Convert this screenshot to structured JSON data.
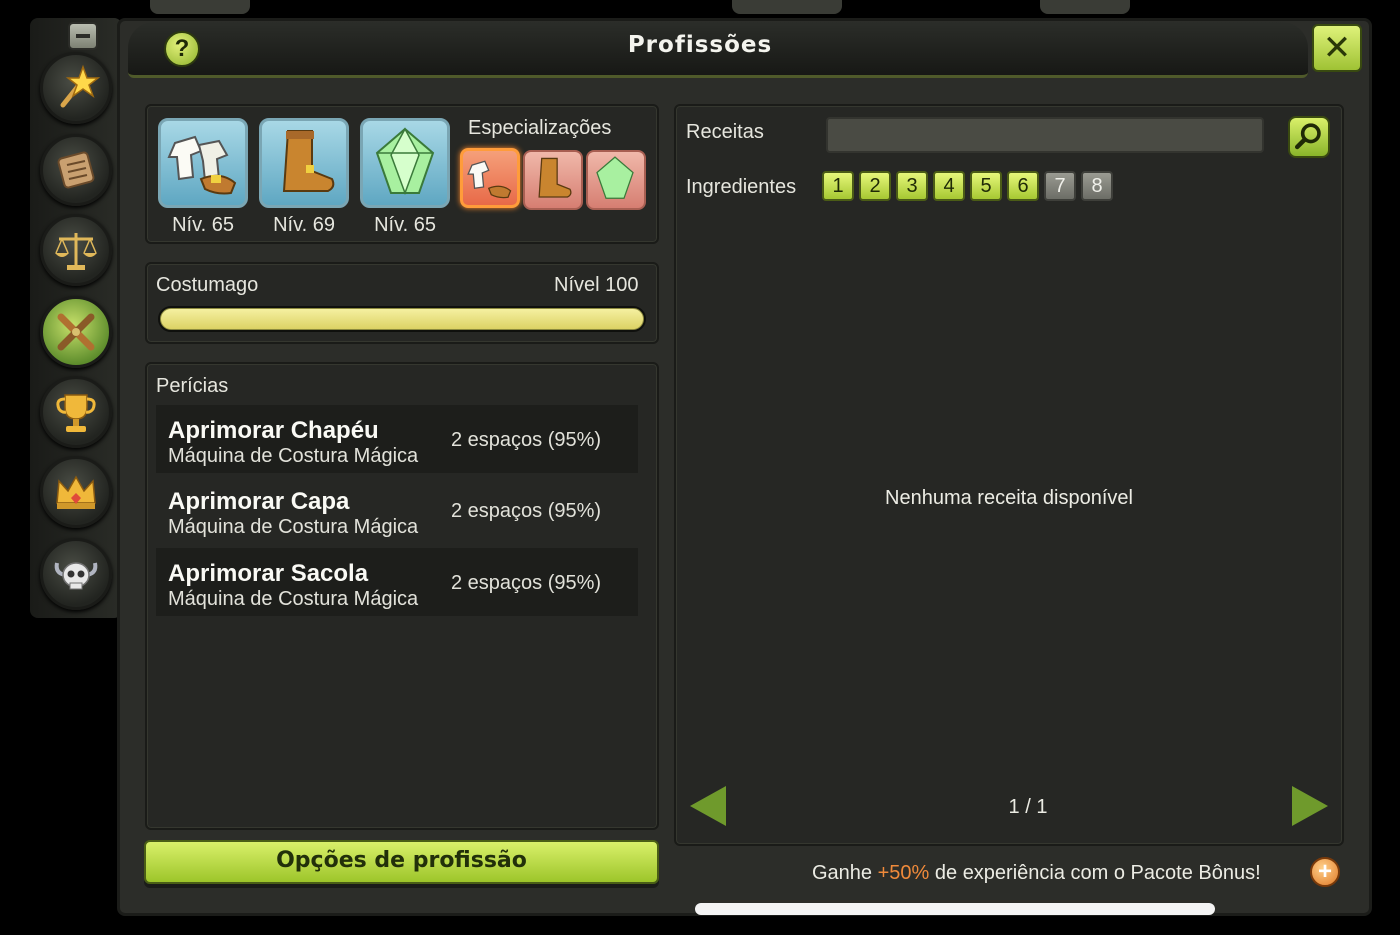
{
  "window": {
    "title": "Profissões",
    "help_label": "?",
    "close_label": "✕"
  },
  "rail": {
    "items": [
      {
        "icon": "star-wand-icon"
      },
      {
        "icon": "scroll-icon"
      },
      {
        "icon": "scales-icon"
      },
      {
        "icon": "crossed-tools-icon",
        "active": true
      },
      {
        "icon": "trophy-icon"
      },
      {
        "icon": "crown-icon"
      },
      {
        "icon": "horned-skull-icon"
      }
    ]
  },
  "professions": {
    "items": [
      {
        "icon": "tailor-clothes-icon",
        "level": "Nív. 65"
      },
      {
        "icon": "boot-icon",
        "level": "Nív. 69"
      },
      {
        "icon": "gem-icon",
        "level": "Nív. 65"
      }
    ],
    "specializations_title": "Especializações"
  },
  "current": {
    "name": "Costumago",
    "level": "Nível 100",
    "progress": 1.0
  },
  "skills": {
    "title": "Perícias",
    "rows": [
      {
        "name": "Aprimorar Chapéu",
        "station": "Máquina de Costura Mágica",
        "slots": "2 espaços (95%)"
      },
      {
        "name": "Aprimorar Capa",
        "station": "Máquina de Costura Mágica",
        "slots": "2 espaços (95%)"
      },
      {
        "name": "Aprimorar Sacola",
        "station": "Máquina de Costura Mágica",
        "slots": "2 espaços (95%)"
      }
    ]
  },
  "options_button": "Opções de profissão",
  "recipes": {
    "search_label": "Receitas",
    "search_value": "",
    "ingredients_label": "Ingredientes",
    "ingredient_buttons": [
      {
        "label": "1",
        "enabled": true
      },
      {
        "label": "2",
        "enabled": true
      },
      {
        "label": "3",
        "enabled": true
      },
      {
        "label": "4",
        "enabled": true
      },
      {
        "label": "5",
        "enabled": true
      },
      {
        "label": "6",
        "enabled": true
      },
      {
        "label": "7",
        "enabled": false
      },
      {
        "label": "8",
        "enabled": false
      }
    ],
    "empty_message": "Nenhuma receita disponível",
    "pager": "1  / 1"
  },
  "promo": {
    "prefix": "Ganhe ",
    "highlight": "+50%",
    "suffix": " de experiência com o Pacote Bônus!"
  },
  "colors": {
    "accent_green": "#a6c832",
    "xp_fill": "#e8e080",
    "highlight_orange": "#f08a3a"
  }
}
